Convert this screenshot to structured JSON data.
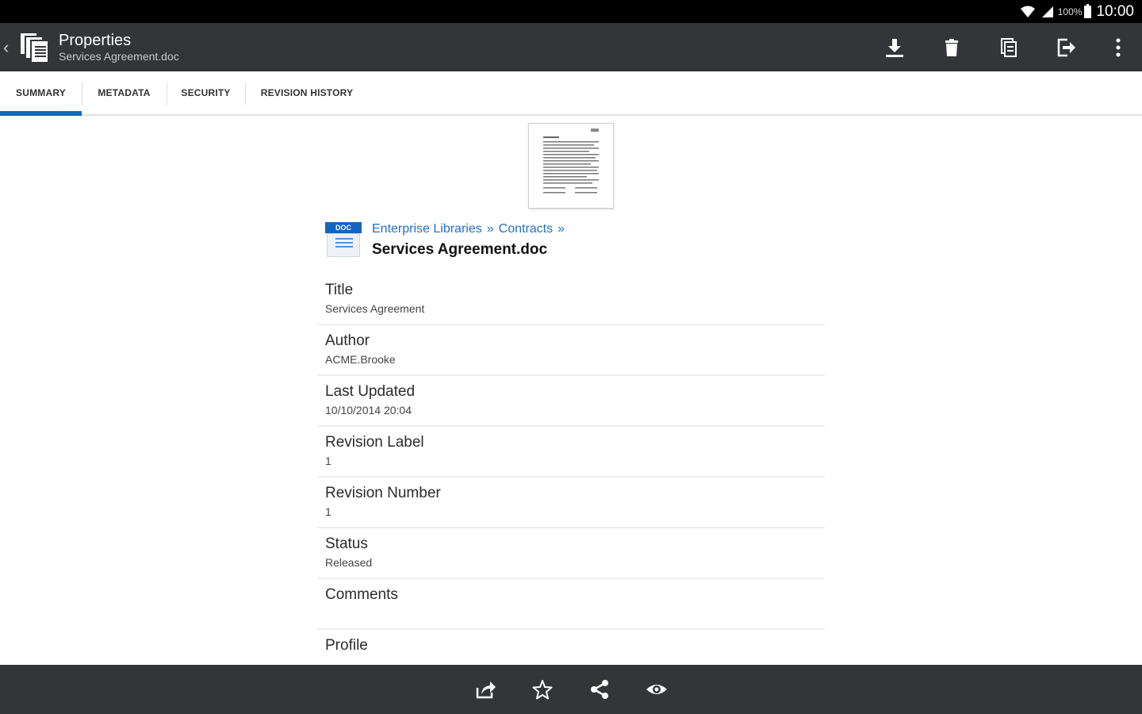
{
  "status_bar": {
    "battery_pct": "100%",
    "time": "10:00"
  },
  "app_bar": {
    "title": "Properties",
    "subtitle": "Services Agreement.doc",
    "actions": [
      "download-icon",
      "trash-icon",
      "copy-icon",
      "move-icon",
      "more-vert-icon"
    ]
  },
  "tabs": [
    {
      "label": "SUMMARY",
      "active": true
    },
    {
      "label": "METADATA",
      "active": false
    },
    {
      "label": "SECURITY",
      "active": false
    },
    {
      "label": "REVISION HISTORY",
      "active": false
    }
  ],
  "file": {
    "type_tag": "DOC",
    "breadcrumb": [
      "Enterprise Libraries",
      "»",
      "Contracts",
      "»"
    ],
    "name": "Services Agreement.doc"
  },
  "properties": [
    {
      "label": "Title",
      "value": "Services Agreement"
    },
    {
      "label": "Author",
      "value": "ACME.Brooke"
    },
    {
      "label": "Last Updated",
      "value": "10/10/2014 20:04"
    },
    {
      "label": "Revision Label",
      "value": "1"
    },
    {
      "label": "Revision Number",
      "value": "1"
    },
    {
      "label": "Status",
      "value": "Released"
    },
    {
      "label": "Comments",
      "value": ""
    },
    {
      "label": "Profile",
      "value": ""
    }
  ],
  "bottom_bar": {
    "actions": [
      "open-with-icon",
      "star-icon",
      "share-icon",
      "view-icon"
    ]
  },
  "colors": {
    "toolbar": "#333539",
    "accent": "#1565c0",
    "link": "#1e6fd0"
  }
}
